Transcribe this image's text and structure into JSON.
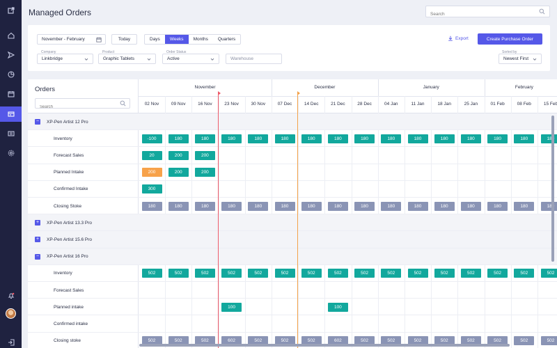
{
  "app": {
    "title": "Managed Orders",
    "search_placeholder": "Search"
  },
  "rail": {
    "icons": [
      "external-link-icon",
      "home-icon",
      "send-icon",
      "pie-chart-icon",
      "calendar-icon",
      "orders-icon",
      "list-icon",
      "settings-icon",
      "bell-icon",
      "avatar",
      "logout-icon"
    ],
    "active": "orders-icon"
  },
  "filters": {
    "date_range": "November - February",
    "today_label": "Today",
    "view_tabs": [
      "Days",
      "Weeks",
      "Months",
      "Quarters"
    ],
    "active_tab": "Weeks",
    "export_label": "Export",
    "create_label": "Create Purchase Order",
    "company": {
      "label": "Company",
      "value": "Linkbridge"
    },
    "product": {
      "label": "Product",
      "value": "Graphic Tablets"
    },
    "order_status": {
      "label": "Order Status",
      "value": "Active"
    },
    "warehouse": {
      "placeholder": "Warehouse"
    },
    "sorted_by": {
      "label": "Sorted by",
      "value": "Newest First"
    }
  },
  "grid": {
    "title": "Orders",
    "search_placeholder": "Search",
    "months": [
      "November",
      "December",
      "January",
      "February"
    ],
    "weeks": [
      "02 Nov",
      "09 Nov",
      "16 Nov",
      "23 Nov",
      "30 Nov",
      "07 Dec",
      "14 Dec",
      "21 Dec",
      "28 Dec",
      "04 Jan",
      "11 Jan",
      "18 Jan",
      "25 Jan",
      "01 Feb",
      "08 Feb",
      "15 Feb"
    ],
    "rows": [
      {
        "type": "product",
        "label": "XP-Pen Artist 12 Pro",
        "expanded": true,
        "toggle": "−"
      },
      {
        "type": "metric",
        "label": "Inventory",
        "cells": [
          "-100",
          "180",
          "180",
          "180",
          "180",
          "180",
          "180",
          "180",
          "180",
          "180",
          "180",
          "180",
          "180",
          "180",
          "180",
          "180"
        ],
        "color": "teal"
      },
      {
        "type": "metric",
        "label": "Forecast Sales",
        "cells": [
          "20",
          "200",
          "200",
          "",
          "",
          "",
          "",
          "",
          "",
          "",
          "",
          "",
          "",
          "",
          "",
          ""
        ],
        "color": "teal"
      },
      {
        "type": "metric",
        "label": "Planned Intake",
        "cells": [
          "200",
          "200",
          "200",
          "",
          "",
          "",
          "",
          "",
          "",
          "",
          "",
          "",
          "",
          "",
          "",
          ""
        ],
        "color": "teal",
        "first_color": "orange"
      },
      {
        "type": "metric",
        "label": "Confirmed Intake",
        "cells": [
          "300",
          "",
          "",
          "",
          "",
          "",
          "",
          "",
          "",
          "",
          "",
          "",
          "",
          "",
          "",
          ""
        ],
        "color": "teal"
      },
      {
        "type": "metric",
        "label": "Closing Stoke",
        "cells": [
          "180",
          "180",
          "180",
          "180",
          "180",
          "180",
          "180",
          "180",
          "180",
          "180",
          "180",
          "180",
          "180",
          "180",
          "180",
          "180"
        ],
        "color": "gray"
      },
      {
        "type": "product",
        "label": "XP-Pen Artist 13.3 Pro",
        "expanded": false,
        "toggle": "+"
      },
      {
        "type": "product",
        "label": "XP-Pen Artist 15.6 Pro",
        "expanded": false,
        "toggle": "+"
      },
      {
        "type": "product",
        "label": "XP-Pen Artist 16 Pro",
        "expanded": true,
        "toggle": "−"
      },
      {
        "type": "metric",
        "label": "Inventory",
        "cells": [
          "502",
          "502",
          "502",
          "502",
          "502",
          "502",
          "502",
          "502",
          "502",
          "502",
          "502",
          "502",
          "502",
          "502",
          "502",
          "502"
        ],
        "color": "teal"
      },
      {
        "type": "metric",
        "label": "Forecast Sales",
        "cells": [
          "",
          "",
          "",
          "",
          "",
          "",
          "",
          "",
          "",
          "",
          "",
          "",
          "",
          "",
          "",
          ""
        ],
        "color": "teal"
      },
      {
        "type": "metric",
        "label": "Planned intake",
        "cells": [
          "",
          "",
          "",
          "100",
          "",
          "",
          "",
          "100",
          "",
          "",
          "",
          "",
          "",
          "",
          "",
          ""
        ],
        "color": "teal"
      },
      {
        "type": "metric",
        "label": "Confirmed intake",
        "cells": [
          "",
          "",
          "",
          "",
          "",
          "",
          "",
          "",
          "",
          "",
          "",
          "",
          "",
          "",
          "",
          ""
        ],
        "color": "teal"
      },
      {
        "type": "metric",
        "label": "Closing stoke",
        "cells": [
          "502",
          "502",
          "502",
          "602",
          "502",
          "502",
          "502",
          "602",
          "502",
          "502",
          "502",
          "502",
          "502",
          "502",
          "502",
          "502"
        ],
        "color": "gray"
      }
    ]
  },
  "colors": {
    "accent": "#5558e8",
    "teal": "#12a89d",
    "gray": "#8a94b5",
    "orange": "#f7a24a",
    "today_marker": "#ee5b6a",
    "second_marker": "#f3a24a"
  }
}
